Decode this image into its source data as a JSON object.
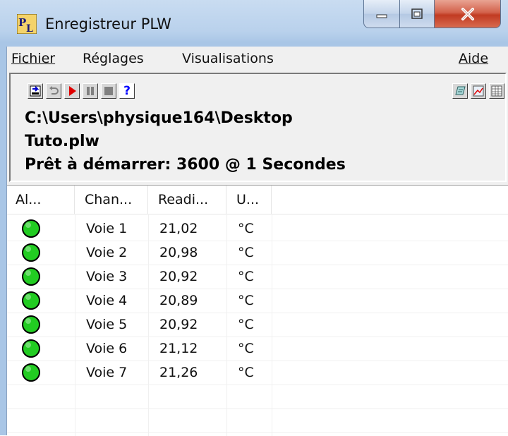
{
  "window": {
    "title": "Enregistreur PLW",
    "icon": "plw-logo-icon",
    "controls": [
      "minimize-icon",
      "maximize-icon",
      "close-icon"
    ]
  },
  "menu": {
    "fichier": "Fichier",
    "reglages": "Réglages",
    "visualisations": "Visualisations",
    "aide": "Aide"
  },
  "toolbar": {
    "left": [
      "save-file-icon",
      "undo-icon",
      "play-record-icon",
      "pause-icon",
      "stop-icon",
      "help-icon"
    ],
    "help_glyph": "?",
    "right": [
      "notes-icon",
      "graph-icon",
      "spreadsheet-icon"
    ],
    "colors": {
      "play": "#e00000",
      "help": "#0000ff",
      "save": "#0000cc"
    }
  },
  "status": {
    "path": "C:\\Users\\physique164\\Desktop",
    "file": "Tuto.plw",
    "state": "Prêt à démarrer: 3600 @ 1 Secondes"
  },
  "table": {
    "headers": [
      "Al...",
      "Chan...",
      "Readi...",
      "U..."
    ],
    "rows": [
      {
        "alarm": "ok",
        "channel": "Voie 1",
        "reading": "21,02",
        "unit": "°C"
      },
      {
        "alarm": "ok",
        "channel": "Voie 2",
        "reading": "20,98",
        "unit": "°C"
      },
      {
        "alarm": "ok",
        "channel": "Voie 3",
        "reading": "20,92",
        "unit": "°C"
      },
      {
        "alarm": "ok",
        "channel": "Voie 4",
        "reading": "20,89",
        "unit": "°C"
      },
      {
        "alarm": "ok",
        "channel": "Voie 5",
        "reading": "20,92",
        "unit": "°C"
      },
      {
        "alarm": "ok",
        "channel": "Voie 6",
        "reading": "21,12",
        "unit": "°C"
      },
      {
        "alarm": "ok",
        "channel": "Voie 7",
        "reading": "21,26",
        "unit": "°C"
      }
    ],
    "alarm_color": "#22cc22"
  }
}
